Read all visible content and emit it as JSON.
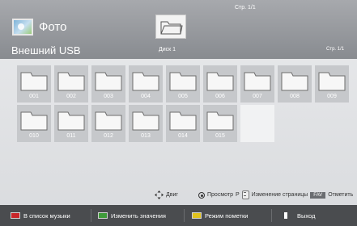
{
  "header": {
    "app_title": "Фото",
    "device_name": "Внешний USB",
    "drive_label": "Диск 1",
    "page_indicator_top": "Стр. 1/1",
    "page_indicator_right": "Стр. 1/1"
  },
  "folders": [
    {
      "label": "001"
    },
    {
      "label": "002"
    },
    {
      "label": "003"
    },
    {
      "label": "004"
    },
    {
      "label": "005"
    },
    {
      "label": "006"
    },
    {
      "label": "007"
    },
    {
      "label": "008"
    },
    {
      "label": "009"
    },
    {
      "label": "010"
    },
    {
      "label": "011"
    },
    {
      "label": "012"
    },
    {
      "label": "013"
    },
    {
      "label": "014"
    },
    {
      "label": "015"
    }
  ],
  "hints": {
    "move": "Двиг",
    "view": "Просмотр",
    "page_letter": "P",
    "page_change": "Изменение страницы",
    "fav": "FAV",
    "mark": "Отметить"
  },
  "actions": {
    "music_list": "В список музыки",
    "change_values": "Изменить значения",
    "mark_mode": "Режим пометки",
    "exit": "Выход"
  },
  "colors": {
    "header_bg": "#989a9e",
    "tile_bg": "#c6c8cb",
    "action_bar_bg": "#4a4c4f",
    "red_key": "#c8262a",
    "green_key": "#3f9b3a",
    "yellow_key": "#e0c21d",
    "blue_key": "#2a62c6"
  },
  "icons": {
    "photo": "photo-icon",
    "folder": "folder-icon",
    "move": "move-arrows-icon",
    "ok": "ok-button-icon",
    "page_updown": "page-updown-icon"
  }
}
